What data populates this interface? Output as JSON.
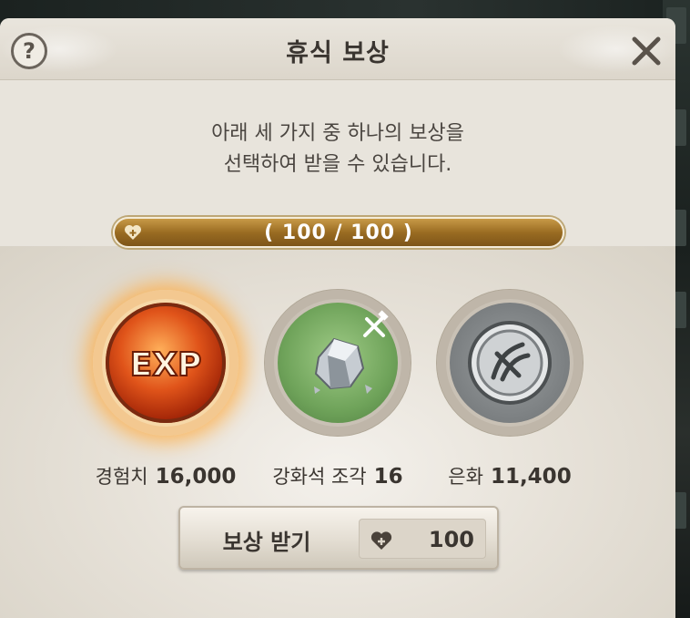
{
  "dialog": {
    "title": "휴식 보상",
    "help_label": "?",
    "description_line1": "아래 세 가지 중 하나의 보상을",
    "description_line2": "선택하여 받을 수 있습니다."
  },
  "stamina": {
    "text": "( 100 / 100 )",
    "current": 100,
    "max": 100,
    "icon": "heart-icon"
  },
  "rewards": [
    {
      "name": "경험치",
      "amount": "16,000",
      "icon": "exp-orb-icon",
      "selected": true
    },
    {
      "name": "강화석 조각",
      "amount": "16",
      "icon": "enhance-stone-fragment-icon",
      "selected": false
    },
    {
      "name": "은화",
      "amount": "11,400",
      "icon": "silver-coin-icon",
      "selected": false
    }
  ],
  "claim_button": {
    "label": "보상 받기",
    "cost": "100",
    "cost_icon": "heart-icon"
  },
  "colors": {
    "panel": "#e8e4dc",
    "gold_bar": "#9a6c22",
    "text": "#3a3530",
    "selected_glow": "#ffaa3c"
  }
}
